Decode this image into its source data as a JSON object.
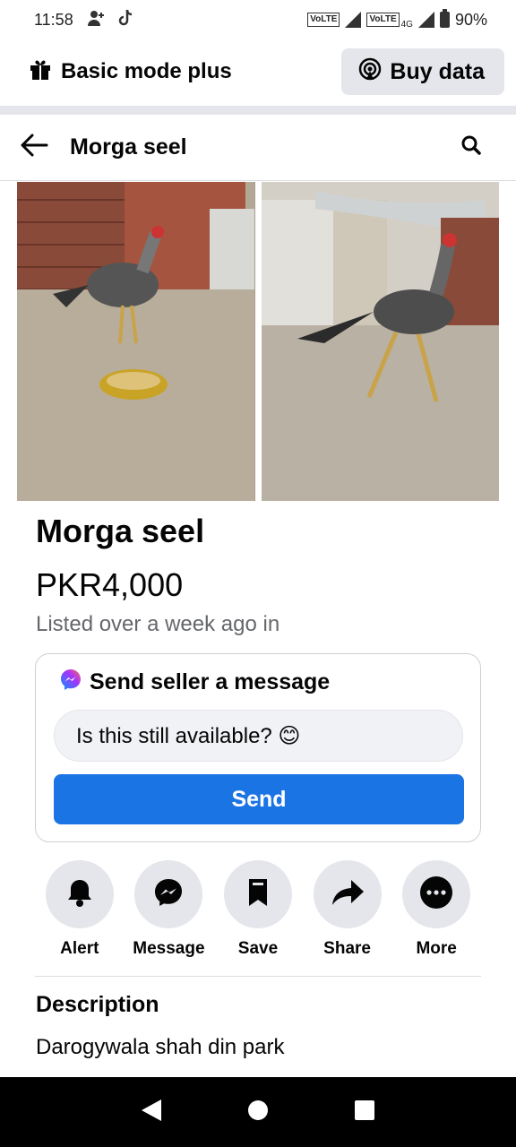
{
  "status_bar": {
    "time": "11:58",
    "network1": "VoLTE",
    "network2": "VoLTE",
    "network2_type": "4G",
    "battery": "90%"
  },
  "mode_bar": {
    "label": "Basic mode plus",
    "buy_data": "Buy data"
  },
  "header": {
    "title": "Morga seel"
  },
  "listing": {
    "title": "Morga seel",
    "price": "PKR4,000",
    "listed": "Listed over a week ago in"
  },
  "message_card": {
    "heading": "Send seller a message",
    "input_value": "Is this still available? 😊",
    "send_label": "Send"
  },
  "actions": [
    {
      "label": "Alert",
      "icon": "bell-icon"
    },
    {
      "label": "Message",
      "icon": "messenger-icon"
    },
    {
      "label": "Save",
      "icon": "bookmark-icon"
    },
    {
      "label": "Share",
      "icon": "share-icon"
    },
    {
      "label": "More",
      "icon": "more-icon"
    }
  ],
  "description": {
    "title": "Description",
    "text": "Darogywala shah din park"
  },
  "colors": {
    "primary": "#1b74e4",
    "secondary_bg": "#e4e6eb",
    "muted_text": "#65676b"
  }
}
